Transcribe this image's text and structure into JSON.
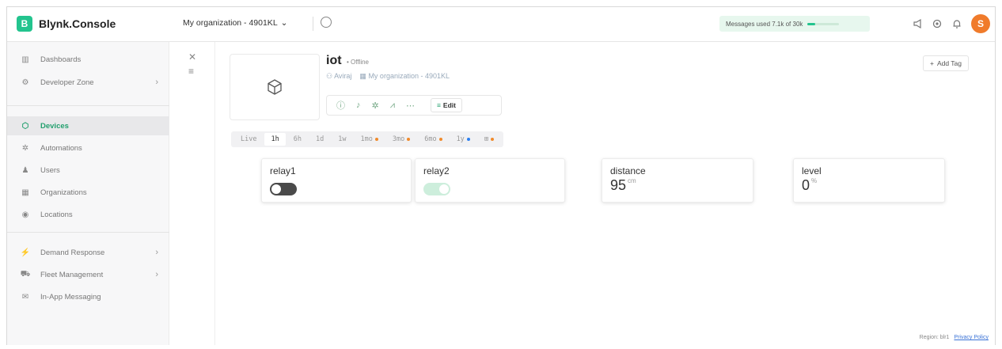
{
  "colors": {
    "accent": "#23c48e",
    "avatar_bg": "#f07b2b",
    "msg_badge_bg": "#e7f7ee"
  },
  "brand": {
    "logo_letter": "B",
    "name": "Blynk.Console"
  },
  "topbar": {
    "org_label": "My organization - 4901KL",
    "messages_text": "Messages used 7.1k of 30k",
    "messages_used_fraction": 0.24,
    "avatar_letter": "S",
    "icons": [
      "megaphone-icon",
      "settings-icon",
      "bell-icon"
    ]
  },
  "sidebar": {
    "items": [
      {
        "label": "Dashboards",
        "icon": "bar-chart-icon"
      },
      {
        "label": "Developer Zone",
        "icon": "developer-icon",
        "has_chevron": true
      },
      {
        "label": "Devices",
        "icon": "cube-icon",
        "active": true
      },
      {
        "label": "Automations",
        "icon": "automation-icon"
      },
      {
        "label": "Users",
        "icon": "users-icon"
      },
      {
        "label": "Organizations",
        "icon": "building-icon"
      },
      {
        "label": "Locations",
        "icon": "location-pin-icon"
      },
      {
        "label": "Demand Response",
        "icon": "demand-icon",
        "has_chevron": true
      },
      {
        "label": "Fleet Management",
        "icon": "truck-icon",
        "has_chevron": true
      },
      {
        "label": "In-App Messaging",
        "icon": "message-icon"
      }
    ]
  },
  "device": {
    "name": "iot",
    "status": "Offline",
    "owner": "Aviraj",
    "organization": "My organization - 4901KL",
    "edit_label": "Edit",
    "add_tag_label": "Add Tag"
  },
  "time_ranges": [
    {
      "label": "Live"
    },
    {
      "label": "1h",
      "selected": true
    },
    {
      "label": "6h"
    },
    {
      "label": "1d"
    },
    {
      "label": "1w"
    },
    {
      "label": "1mo",
      "dot": "orange"
    },
    {
      "label": "3mo",
      "dot": "orange"
    },
    {
      "label": "6mo",
      "dot": "orange"
    },
    {
      "label": "1y",
      "dot": "blue"
    },
    {
      "label": "⊞",
      "dot": "orange"
    }
  ],
  "widgets": {
    "relay1": {
      "title": "relay1",
      "state": "off"
    },
    "relay2": {
      "title": "relay2",
      "state": "on"
    },
    "distance": {
      "title": "distance",
      "value": "95",
      "unit": "cm"
    },
    "level": {
      "title": "level",
      "value": "0",
      "unit": "%"
    }
  },
  "footer": {
    "region": "Region: blr1",
    "privacy": "Privacy Policy"
  }
}
